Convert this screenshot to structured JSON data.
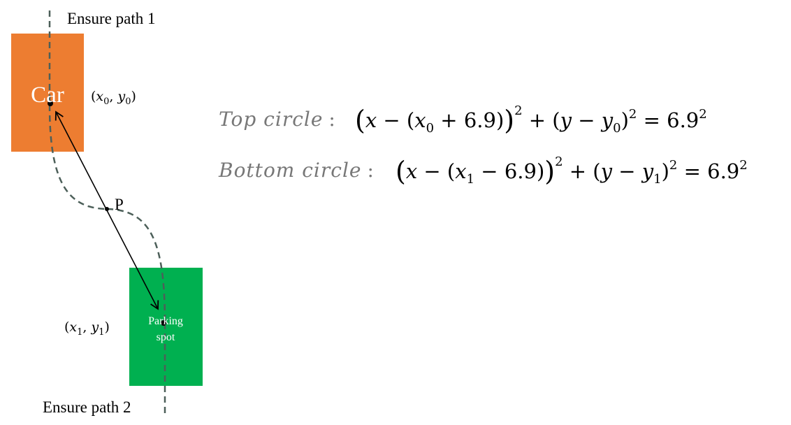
{
  "labels": {
    "path1": "Ensure path 1",
    "path2": "Ensure path 2",
    "car": "Car",
    "parking_line1": "Parking",
    "parking_line2": "spot",
    "point_p": "P"
  },
  "coords": {
    "car": {
      "x": "x",
      "sub_x": "0",
      "y": "y",
      "sub_y": "0"
    },
    "spot": {
      "x": "x",
      "sub_x": "1",
      "y": "y",
      "sub_y": "1"
    }
  },
  "equations": {
    "top_label": "Top circle",
    "bottom_label": "Bottom circle",
    "sep": ":",
    "top": {
      "sign": "+",
      "sub_x": "0",
      "sub_y": "0"
    },
    "bottom": {
      "sign": "−",
      "sub_x": "1",
      "sub_y": "1"
    },
    "radius": "6.9",
    "exponent": "2"
  },
  "colors": {
    "car_fill": "#ED7D31",
    "spot_fill": "#00B050",
    "path_stroke": "#4C5F59",
    "equation_label": "#777777",
    "text": "#000000"
  }
}
